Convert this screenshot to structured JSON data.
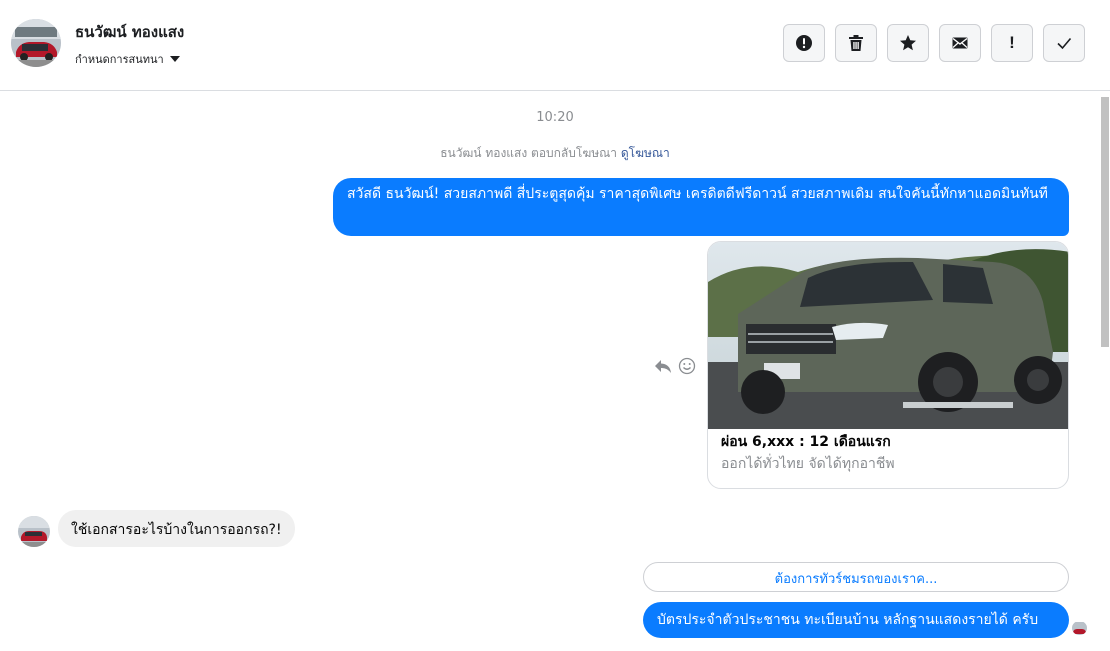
{
  "header": {
    "contact_name": "ธนวัฒน์ ทองแสง",
    "conversation_settings": "กำหนดการสนทนา",
    "actions": [
      {
        "name": "report-spam",
        "icon": "alert-circle-icon"
      },
      {
        "name": "delete",
        "icon": "trash-icon"
      },
      {
        "name": "star",
        "icon": "star-icon"
      },
      {
        "name": "mark-unread",
        "icon": "envelope-icon"
      },
      {
        "name": "important",
        "icon": "exclamation-icon",
        "glyph": "!"
      },
      {
        "name": "mark-done",
        "icon": "check-icon"
      }
    ]
  },
  "chat": {
    "timestamp": "10:20",
    "ad_reply_note": "ธนวัฒน์ ทองแสง ตอบกลับโฆษณา",
    "ad_reply_link": "ดูโฆษณา",
    "messages": [
      {
        "direction": "out",
        "text": "สวัสดี ธนวัฒน์! สวยสภาพดี สี่ประตูสุดคุ้ม ราคาสุดพิเศษ เครดิตดีฟรีดาวน์ สวยสภาพเดิม สนใจคันนี้ทักหาแอดมินทันที"
      },
      {
        "direction": "in",
        "text": "ใช้เอกสารอะไรบ้างในการออกรถ?!"
      },
      {
        "direction": "out",
        "text": "บัตรประจำตัวประชาชน ทะเบียนบ้าน หลักฐานแสดงรายได้ ครับ"
      }
    ],
    "ad_card": {
      "title": "ผ่อน 6,xxx : 12 เดือนแรก",
      "subtitle": "ออกได้ทั่วไทย จัดได้ทุกอาชีพ"
    },
    "quick_reply": "ต้องการทัวร์ชมรถของเราค..."
  },
  "colors": {
    "accent": "#0a7cff",
    "incoming_bubble": "#f0f0f0",
    "muted_text": "#8a8d91",
    "link": "#365899"
  }
}
